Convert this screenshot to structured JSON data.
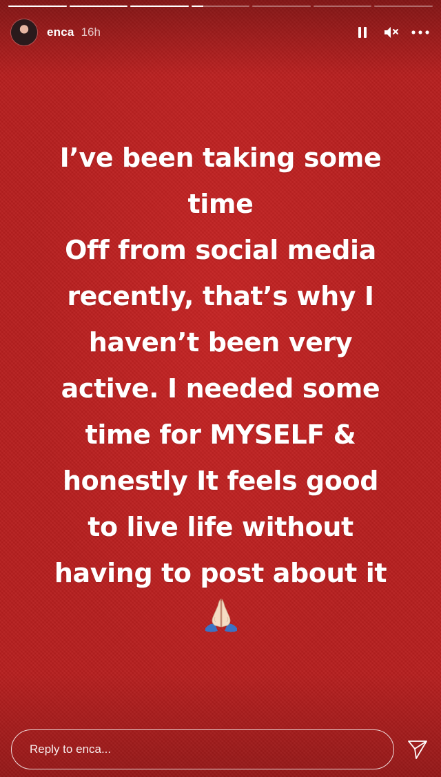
{
  "progress": {
    "segments": [
      1,
      1,
      1,
      0.2,
      0,
      0,
      0
    ]
  },
  "header": {
    "username": "enca",
    "time_ago": "16h",
    "icons": [
      "pause-icon",
      "mute-icon",
      "more-icon"
    ]
  },
  "story": {
    "lines": [
      "I’ve been taking some",
      "time",
      "Off from social media",
      "recently, that’s why I",
      "haven’t been very",
      "active. I needed some",
      "time for MYSELF &",
      "honestly It feels good",
      "to live life without",
      "having to post about it"
    ],
    "emoji": "folded-hands-emoji"
  },
  "reply": {
    "placeholder": "Reply to enca..."
  },
  "colors": {
    "background": "#b71f1f",
    "text": "#ffffff"
  }
}
